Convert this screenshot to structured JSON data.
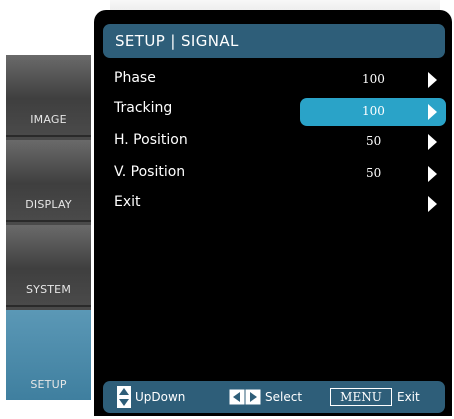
{
  "title": "SETUP | SIGNAL",
  "sidebar": {
    "items": [
      {
        "label": "IMAGE"
      },
      {
        "label": "DISPLAY"
      },
      {
        "label": "SYSTEM"
      },
      {
        "label": "SETUP"
      }
    ],
    "active": "SETUP"
  },
  "menu": {
    "items": [
      {
        "label": "Phase",
        "value": "100"
      },
      {
        "label": "Tracking",
        "value": "100"
      },
      {
        "label": "H. Position",
        "value": "50"
      },
      {
        "label": "V. Position",
        "value": "50"
      },
      {
        "label": "Exit",
        "value": ""
      }
    ],
    "selected": "Tracking"
  },
  "footer": {
    "updown_label": "UpDown",
    "select_label": "Select",
    "menu_key": "MENU",
    "exit_label": "Exit"
  },
  "colors": {
    "title_bar": "#2e5e79",
    "highlight": "#2aa3c8",
    "active_tab": "#4a8aab",
    "panel": "#000000",
    "text": "#ffffff"
  },
  "icons": {
    "row_arrow": "triangle-right-icon",
    "updown": "up-down-icon",
    "select": "left-right-icon"
  }
}
